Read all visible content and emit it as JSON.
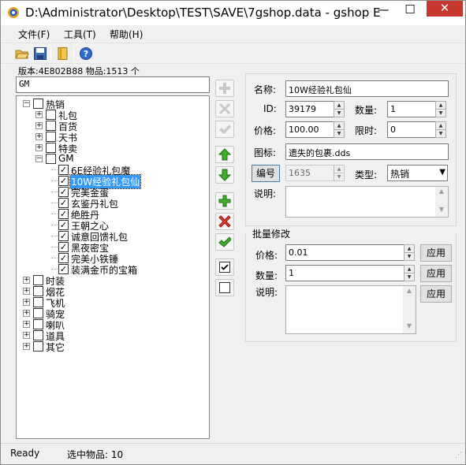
{
  "window": {
    "title": "D:\\Administrator\\Desktop\\TEST\\SAVE\\7gshop.data - gshop E...",
    "min_glyph": "—",
    "max_glyph": "☐",
    "close_glyph": "✕"
  },
  "menu": [
    {
      "label": "文件(F)"
    },
    {
      "label": "工具(T)"
    },
    {
      "label": "帮助(H)"
    }
  ],
  "toolbar_icons": [
    "open-folder-icon",
    "save-icon",
    "book-icon",
    "help-icon"
  ],
  "version_line": "版本:4E802B88 物品:1513 个",
  "search": {
    "value": "GM"
  },
  "tree": {
    "root": {
      "label": "热销",
      "expanded": true
    },
    "children": [
      {
        "label": "礼包",
        "expanded": false
      },
      {
        "label": "百货",
        "expanded": false
      },
      {
        "label": "天书",
        "expanded": false
      },
      {
        "label": "特卖",
        "expanded": false
      },
      {
        "label": "GM",
        "expanded": true
      }
    ],
    "gm_items": [
      {
        "label": "6E经验礼包魔",
        "checked": true,
        "selected": false
      },
      {
        "label": "10W经验礼包仙",
        "checked": true,
        "selected": true
      },
      {
        "label": "完美金蛋",
        "checked": true,
        "selected": false
      },
      {
        "label": "玄鉴丹礼包",
        "checked": true,
        "selected": false
      },
      {
        "label": "绝胜丹",
        "checked": true,
        "selected": false
      },
      {
        "label": "王朝之心",
        "checked": true,
        "selected": false
      },
      {
        "label": "诚意回馈礼包",
        "checked": true,
        "selected": false
      },
      {
        "label": "黑夜密宝",
        "checked": true,
        "selected": false
      },
      {
        "label": "完美小铁锤",
        "checked": true,
        "selected": false
      },
      {
        "label": "装满金币的宝箱",
        "checked": true,
        "selected": false
      }
    ],
    "top_level": [
      {
        "label": "时装"
      },
      {
        "label": "烟花"
      },
      {
        "label": "飞机"
      },
      {
        "label": "骑宠"
      },
      {
        "label": "喇叭"
      },
      {
        "label": "道具"
      },
      {
        "label": "其它"
      }
    ]
  },
  "side_buttons": [
    "add-gray-icon",
    "delete-gray-icon",
    "check-gray-icon",
    "up-arrow-icon",
    "down-arrow-icon",
    "add-icon",
    "delete-icon",
    "check-icon",
    "check-all-icon",
    "uncheck-all-icon"
  ],
  "item": {
    "name_label": "名称:",
    "name": "10W经验礼包仙",
    "id_label": "ID:",
    "id": "39179",
    "qty_label": "数量:",
    "qty": "1",
    "price_label": "价格:",
    "price": "100.00",
    "limit_label": "限时:",
    "limit": "0",
    "icon_label": "图标:",
    "icon": "遗失的包裹.dds",
    "code_button": "编号",
    "code": "1635",
    "type_label": "类型:",
    "type": "热销",
    "desc_label": "说明:",
    "desc": ""
  },
  "batch": {
    "title": "批量修改",
    "price_label": "价格:",
    "price": "0.01",
    "qty_label": "数量:",
    "qty": "1",
    "desc_label": "说明:",
    "desc": "",
    "apply_label": "应用"
  },
  "status": {
    "ready": "Ready",
    "selected": "选中物品: 10"
  }
}
